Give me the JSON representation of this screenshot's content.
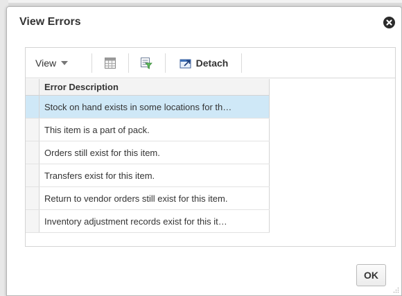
{
  "dialog": {
    "title": "View Errors",
    "close_icon": "close-icon"
  },
  "toolbar": {
    "view_label": "View",
    "freeze_icon": "freeze-columns-icon",
    "filter_icon": "query-by-example-icon",
    "detach_label": "Detach",
    "detach_icon": "detach-icon"
  },
  "table": {
    "columns": [
      "Error Description"
    ],
    "rows": [
      "Stock on hand exists in some locations for th…",
      "This item is a part of pack.",
      "Orders still exist for this item.",
      "Transfers exist for this item.",
      "Return to vendor orders still exist for this item.",
      "Inventory adjustment records exist for this it…"
    ],
    "selected_row": 0
  },
  "footer": {
    "ok_label": "OK"
  },
  "colors": {
    "selection": "#cfe8f7",
    "header_bg": "#f3f3f3",
    "close_icon_bg": "#2b2b2b"
  }
}
